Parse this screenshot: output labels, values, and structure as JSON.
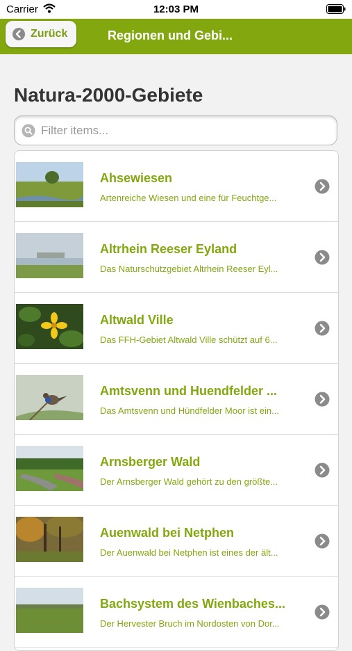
{
  "status_bar": {
    "carrier": "Carrier",
    "time": "12:03 PM"
  },
  "nav": {
    "back_label": "Zurück",
    "title": "Regionen und Gebi..."
  },
  "page": {
    "title": "Natura-2000-Gebiete"
  },
  "search": {
    "placeholder": "Filter items..."
  },
  "colors": {
    "accent": "#83a80f",
    "nav_bg": "#83a80f",
    "title_text": "#333333"
  },
  "items": [
    {
      "title": "Ahsewiesen",
      "description": "Artenreiche Wiesen und eine für Feuchtge...",
      "image": "meadow-with-stream"
    },
    {
      "title": "Altrhein Reeser Eyland",
      "description": "Das Naturschutzgebiet Altrhein Reeser Eyl...",
      "image": "river-landscape"
    },
    {
      "title": "Altwald Ville",
      "description": "Das FFH-Gebiet Altwald Ville schützt auf 6...",
      "image": "yellow-flower"
    },
    {
      "title": "Amtsvenn und Huendfelder ...",
      "description": "Das Amtsvenn und Hündfelder Moor ist ein...",
      "image": "bluethroat-bird"
    },
    {
      "title": "Arnsberger Wald",
      "description": "Der Arnsberger Wald gehört zu den größte...",
      "image": "forest-stream"
    },
    {
      "title": "Auenwald bei Netphen",
      "description": "Der Auenwald bei Netphen ist eines der ält...",
      "image": "autumn-forest"
    },
    {
      "title": "Bachsystem des Wienbaches...",
      "description": "Der Hervester Bruch im Nordosten von Dor...",
      "image": "green-field"
    }
  ]
}
